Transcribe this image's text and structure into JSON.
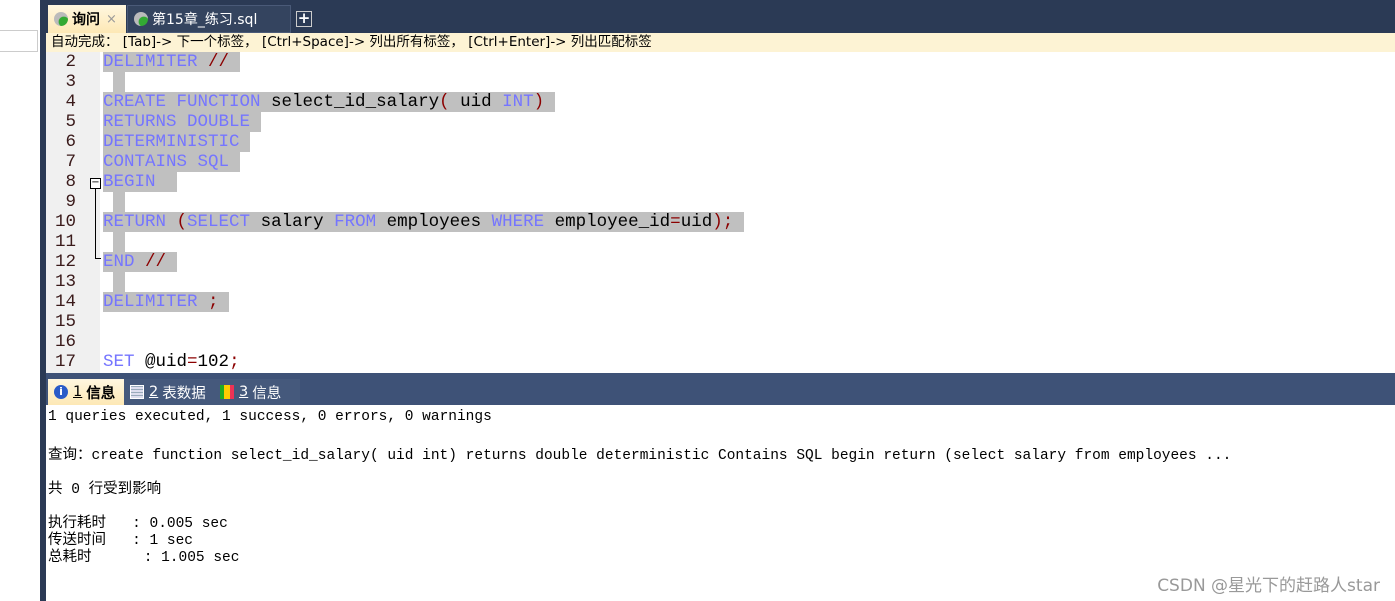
{
  "tabs": [
    {
      "label": "询问",
      "close": "×",
      "active": true
    },
    {
      "label": "第15章_练习.sql",
      "active": false
    }
  ],
  "new_tab": "+",
  "hint": "自动完成： [Tab]-> 下一个标签， [Ctrl+Space]-> 列出所有标签， [Ctrl+Enter]-> 列出匹配标签",
  "code_lines": [
    {
      "n": "2",
      "sel": true,
      "tokens": [
        [
          "kw",
          "DELIMITER"
        ],
        [
          "tx",
          " "
        ],
        [
          "op",
          "//"
        ],
        [
          "tx",
          " "
        ]
      ]
    },
    {
      "n": "3",
      "sel": true,
      "tokens": []
    },
    {
      "n": "4",
      "sel": true,
      "tokens": [
        [
          "kw",
          "CREATE"
        ],
        [
          "tx",
          " "
        ],
        [
          "kw",
          "FUNCTION"
        ],
        [
          "tx",
          " select_id_salary"
        ],
        [
          "op",
          "("
        ],
        [
          "tx",
          " uid "
        ],
        [
          "kw",
          "INT"
        ],
        [
          "op",
          ")"
        ],
        [
          "tx",
          " "
        ]
      ]
    },
    {
      "n": "5",
      "sel": true,
      "tokens": [
        [
          "kw",
          "RETURNS"
        ],
        [
          "tx",
          " "
        ],
        [
          "kw",
          "DOUBLE"
        ],
        [
          "tx",
          " "
        ]
      ]
    },
    {
      "n": "6",
      "sel": true,
      "tokens": [
        [
          "kw",
          "DETERMINISTIC"
        ],
        [
          "tx",
          " "
        ]
      ]
    },
    {
      "n": "7",
      "sel": true,
      "tokens": [
        [
          "kw",
          "CONTAINS"
        ],
        [
          "tx",
          " "
        ],
        [
          "kw",
          "SQL"
        ],
        [
          "tx",
          " "
        ]
      ]
    },
    {
      "n": "8",
      "sel": true,
      "tokens": [
        [
          "kw",
          "BEGIN"
        ],
        [
          "tx",
          "  "
        ]
      ]
    },
    {
      "n": "9",
      "sel": true,
      "tokens": []
    },
    {
      "n": "10",
      "sel": true,
      "tokens": [
        [
          "kw",
          "RETURN"
        ],
        [
          "tx",
          " "
        ],
        [
          "op",
          "("
        ],
        [
          "kw",
          "SELECT"
        ],
        [
          "tx",
          " salary "
        ],
        [
          "kw",
          "FROM"
        ],
        [
          "tx",
          " employees "
        ],
        [
          "kw",
          "WHERE"
        ],
        [
          "tx",
          " employee_id"
        ],
        [
          "op",
          "="
        ],
        [
          "tx",
          "uid"
        ],
        [
          "op",
          ");"
        ],
        [
          "tx",
          " "
        ]
      ]
    },
    {
      "n": "11",
      "sel": true,
      "tokens": []
    },
    {
      "n": "12",
      "sel": true,
      "tokens": [
        [
          "kw",
          "END"
        ],
        [
          "tx",
          " "
        ],
        [
          "op",
          "//"
        ],
        [
          "tx",
          " "
        ]
      ]
    },
    {
      "n": "13",
      "sel": true,
      "tokens": []
    },
    {
      "n": "14",
      "sel": true,
      "tokens": [
        [
          "kw",
          "DELIMITER"
        ],
        [
          "tx",
          " "
        ],
        [
          "op",
          ";"
        ],
        [
          "tx",
          " "
        ]
      ]
    },
    {
      "n": "15",
      "sel": false,
      "tokens": []
    },
    {
      "n": "16",
      "sel": false,
      "tokens": []
    },
    {
      "n": "17",
      "sel": false,
      "tokens": [
        [
          "kw",
          "SET"
        ],
        [
          "tx",
          " @uid"
        ],
        [
          "op",
          "="
        ],
        [
          "tx",
          "102"
        ],
        [
          "op",
          ";"
        ]
      ]
    }
  ],
  "result_tabs": [
    {
      "num": "1",
      "label": "信息",
      "icon": "info-icon"
    },
    {
      "num": "2",
      "label": "表数据",
      "icon": "table-icon"
    },
    {
      "num": "3",
      "label": "信息",
      "icon": "shapes-icon"
    }
  ],
  "output": [
    "1 queries executed, 1 success, 0 errors, 0 warnings",
    "",
    "查询：create function select_id_salary( uid int) returns double deterministic Contains SQL begin return (select salary from employees ...",
    "",
    "共 0 行受到影响",
    "",
    "执行耗时   : 0.005 sec",
    "传送时间   : 1 sec",
    "总耗时      : 1.005 sec"
  ],
  "watermark": "CSDN @星光下的赶路人star",
  "colors": {
    "keyword": "#7575ff",
    "operator": "#8b0000",
    "selection": "#c0c0c0",
    "tabbar": "#2b3a55"
  }
}
